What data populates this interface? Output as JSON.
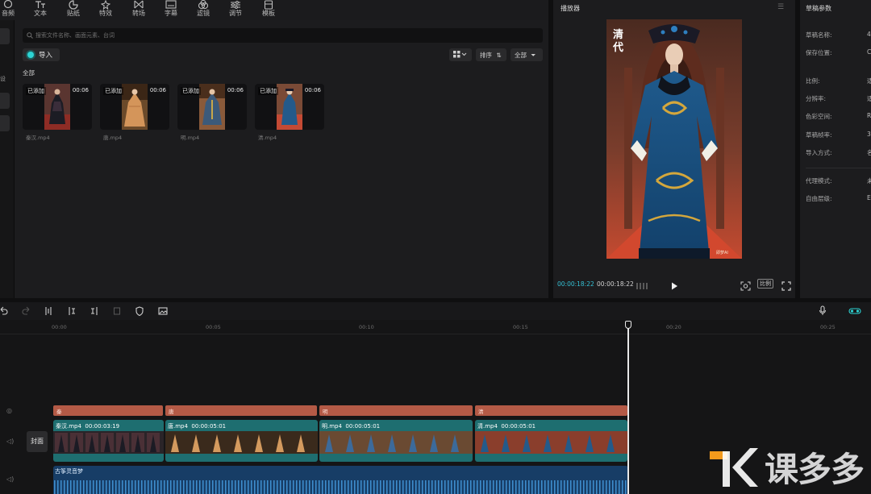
{
  "toolbar": {
    "items": [
      {
        "label": "音频",
        "icon": "audio-icon"
      },
      {
        "label": "文本",
        "icon": "text-icon"
      },
      {
        "label": "贴纸",
        "icon": "sticker-icon"
      },
      {
        "label": "特效",
        "icon": "effects-icon"
      },
      {
        "label": "转场",
        "icon": "transition-icon"
      },
      {
        "label": "字幕",
        "icon": "subtitle-icon"
      },
      {
        "label": "滤镜",
        "icon": "filter-icon"
      },
      {
        "label": "调节",
        "icon": "adjust-icon"
      },
      {
        "label": "模板",
        "icon": "template-icon"
      }
    ]
  },
  "media": {
    "search_placeholder": "搜索文件名称、画面元素、台词",
    "import_label": "导入",
    "sort_label": "排序",
    "filter_label": "全部",
    "section_title": "全部",
    "left_label": "设",
    "cards": [
      {
        "added": "已添加",
        "duration": "00:06",
        "name": "秦汉.mp4"
      },
      {
        "added": "已添加",
        "duration": "00:06",
        "name": "唐.mp4"
      },
      {
        "added": "已添加",
        "duration": "00:06",
        "name": "明.mp4"
      },
      {
        "added": "已添加",
        "duration": "00:06",
        "name": "清.mp4"
      }
    ]
  },
  "player": {
    "title": "播放器",
    "caption": "清代",
    "watermark": "即梦AI",
    "current_time": "00:00:18:22",
    "total_time": "00:00:18:22",
    "ratio_label": "比例"
  },
  "params": {
    "title": "草稿参数",
    "rows": [
      {
        "label": "草稿名称:",
        "value": "4"
      },
      {
        "label": "保存位置:",
        "value": "C"
      },
      {
        "label": "比例:",
        "value": "适"
      },
      {
        "label": "分辨率:",
        "value": "适"
      },
      {
        "label": "色彩空间:",
        "value": "R"
      },
      {
        "label": "草稿帧率:",
        "value": "3"
      },
      {
        "label": "导入方式:",
        "value": "名"
      },
      {
        "label": "代理模式:",
        "value": "未"
      },
      {
        "label": "自由层级:",
        "value": "E"
      }
    ]
  },
  "timeline": {
    "ruler": [
      "00:00",
      "00:05",
      "00:10",
      "00:15",
      "00:20",
      "00:25"
    ],
    "text_clips": [
      "秦",
      "唐",
      "明",
      "清"
    ],
    "video_clips": [
      {
        "name": "秦汉.mp4",
        "duration": "00:00:03:19"
      },
      {
        "name": "唐.mp4",
        "duration": "00:00:05:01"
      },
      {
        "name": "明.mp4",
        "duration": "00:00:05:01"
      },
      {
        "name": "清.mp4",
        "duration": "00:00:05:01"
      }
    ],
    "cover_label": "封面",
    "audio_label": "古筝灵音梦"
  },
  "brand": {
    "text": "课多多",
    "logo_color": "#f39a1c"
  },
  "colors": {
    "accent": "#2dd4d4",
    "text_clip": "#b45a46",
    "video_clip": "#1e6e70",
    "audio_clip": "#173d66"
  }
}
